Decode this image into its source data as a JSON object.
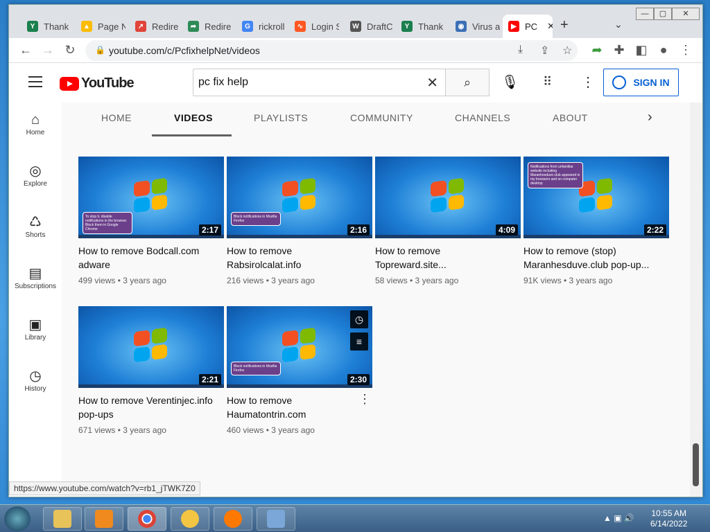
{
  "browser": {
    "tabs": [
      {
        "label": "Thank",
        "fav": "#1a7f4e",
        "glyph": "Y"
      },
      {
        "label": "Page N",
        "fav": "#fbbc04",
        "glyph": "▲"
      },
      {
        "label": "Redire",
        "fav": "#e0443a",
        "glyph": "↗"
      },
      {
        "label": "Redire",
        "fav": "#2e8b57",
        "glyph": "➦"
      },
      {
        "label": "rickroll",
        "fav": "#4285f4",
        "glyph": "G"
      },
      {
        "label": "Login S",
        "fav": "#ff5722",
        "glyph": "∿"
      },
      {
        "label": "DraftC",
        "fav": "#555555",
        "glyph": "W"
      },
      {
        "label": "Thank",
        "fav": "#1a7f4e",
        "glyph": "Y"
      },
      {
        "label": "Virus a",
        "fav": "#3b6fb6",
        "glyph": "◉"
      },
      {
        "label": "PC",
        "fav": "#ff0000",
        "glyph": "▶"
      }
    ],
    "url": "youtube.com/c/PcfixhelpNet/videos",
    "status_url": "https://www.youtube.com/watch?v=rb1_jTWK7Z0"
  },
  "youtube": {
    "logo_text": "YouTube",
    "search_value": "pc fix help",
    "sign_in": "SIGN IN",
    "sidebar": [
      {
        "label": "Home",
        "icon": "⌂"
      },
      {
        "label": "Explore",
        "icon": "◎"
      },
      {
        "label": "Shorts",
        "icon": "♺"
      },
      {
        "label": "Subscriptions",
        "icon": "▤"
      },
      {
        "label": "Library",
        "icon": "▣"
      },
      {
        "label": "History",
        "icon": "◷"
      }
    ],
    "channel_tabs": [
      "HOME",
      "VIDEOS",
      "PLAYLISTS",
      "COMMUNITY",
      "CHANNELS",
      "ABOUT"
    ],
    "videos": [
      {
        "title": "How to remove Bodcall.com adware",
        "meta": "499 views • 3 years ago",
        "duration": "2:17",
        "popup": "To stop it, disable notifications in the browser. Block them in Google Chrome"
      },
      {
        "title": "How to remove Rabsirolcalat.info",
        "meta": "216 views • 3 years ago",
        "duration": "2:16",
        "popup": "Block notifications in Mozilla Firefox"
      },
      {
        "title": "How to remove Topreward.site...",
        "meta": "58 views • 3 years ago",
        "duration": "4:09",
        "popup": ""
      },
      {
        "title": "How to remove (stop) Maranhesduve.club pop-up...",
        "meta": "91K views • 3 years ago",
        "duration": "2:22",
        "popup": "Notifications from unfamiliar website including Maranhesduve.club appeared in my browsers and on computer desktop"
      },
      {
        "title": "How to remove Verentinjec.info pop-ups",
        "meta": "671 views • 3 years ago",
        "duration": "2:21",
        "popup": ""
      },
      {
        "title": "How to remove Haumatontrin.com",
        "meta": "460 views • 3 years ago",
        "duration": "2:30",
        "popup": "Block notifications in Mozilla Firefox"
      }
    ]
  },
  "taskbar": {
    "time": "10:55 AM",
    "date": "6/14/2022"
  }
}
